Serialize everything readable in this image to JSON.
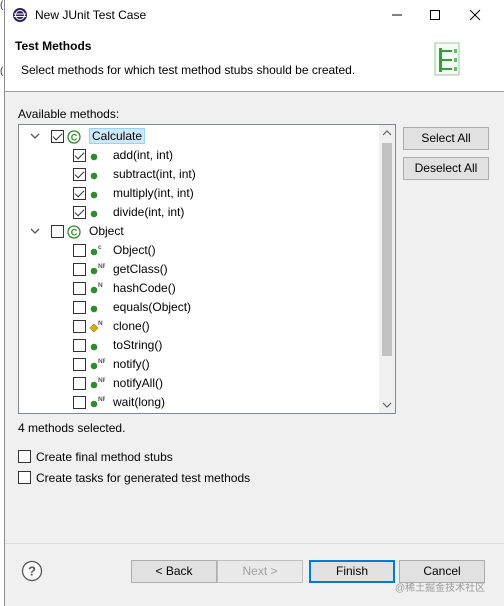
{
  "window": {
    "title": "New JUnit Test Case",
    "minimize_icon": "minimize-icon",
    "maximize_icon": "maximize-icon",
    "close_icon": "close-icon"
  },
  "banner": {
    "title": "Test Methods",
    "description": "Select methods for which test method stubs should be created.",
    "image_icon": "junit-wizard-banner-icon"
  },
  "available_label": "Available methods:",
  "tree": {
    "nodes": [
      {
        "label": "Calculate",
        "type": "class",
        "expanded": true,
        "checked": true,
        "selected": true
      },
      {
        "label": "add(int, int)",
        "type": "method",
        "checked": true,
        "icon": "public-method-icon",
        "badge": ""
      },
      {
        "label": "subtract(int, int)",
        "type": "method",
        "checked": true,
        "icon": "public-method-icon",
        "badge": ""
      },
      {
        "label": "multiply(int, int)",
        "type": "method",
        "checked": true,
        "icon": "public-method-icon",
        "badge": ""
      },
      {
        "label": "divide(int, int)",
        "type": "method",
        "checked": true,
        "icon": "public-method-icon",
        "badge": ""
      },
      {
        "label": "Object",
        "type": "class",
        "expanded": true,
        "checked": false,
        "selected": false
      },
      {
        "label": "Object()",
        "type": "method",
        "checked": false,
        "icon": "constructor-icon",
        "badge": "c"
      },
      {
        "label": "getClass()",
        "type": "method",
        "checked": false,
        "icon": "native-final-method-icon",
        "badge": "NF"
      },
      {
        "label": "hashCode()",
        "type": "method",
        "checked": false,
        "icon": "native-method-icon",
        "badge": "N"
      },
      {
        "label": "equals(Object)",
        "type": "method",
        "checked": false,
        "icon": "public-method-icon",
        "badge": ""
      },
      {
        "label": "clone()",
        "type": "method",
        "checked": false,
        "icon": "protected-native-method-icon",
        "badge": "N"
      },
      {
        "label": "toString()",
        "type": "method",
        "checked": false,
        "icon": "public-method-icon",
        "badge": ""
      },
      {
        "label": "notify()",
        "type": "method",
        "checked": false,
        "icon": "native-final-method-icon",
        "badge": "NF"
      },
      {
        "label": "notifyAll()",
        "type": "method",
        "checked": false,
        "icon": "native-final-method-icon",
        "badge": "NF"
      },
      {
        "label": "wait(long)",
        "type": "method",
        "checked": false,
        "icon": "native-final-method-icon",
        "badge": "NF"
      }
    ]
  },
  "buttons": {
    "select_all": "Select All",
    "deselect_all": "Deselect All",
    "back": "< Back",
    "next": "Next >",
    "finish": "Finish",
    "cancel": "Cancel"
  },
  "status": "4 methods selected.",
  "options": {
    "final_stubs": {
      "label": "Create final method stubs",
      "checked": false
    },
    "tasks": {
      "label": "Create tasks for generated test methods",
      "checked": false
    }
  },
  "help_icon": "help-icon",
  "watermark": "@稀土掘金技术社区",
  "colors": {
    "selection": "#cce8ff",
    "public_method": "#2e8b2e",
    "protected_method": "#d8b000",
    "default_button_border": "#0078d7"
  }
}
